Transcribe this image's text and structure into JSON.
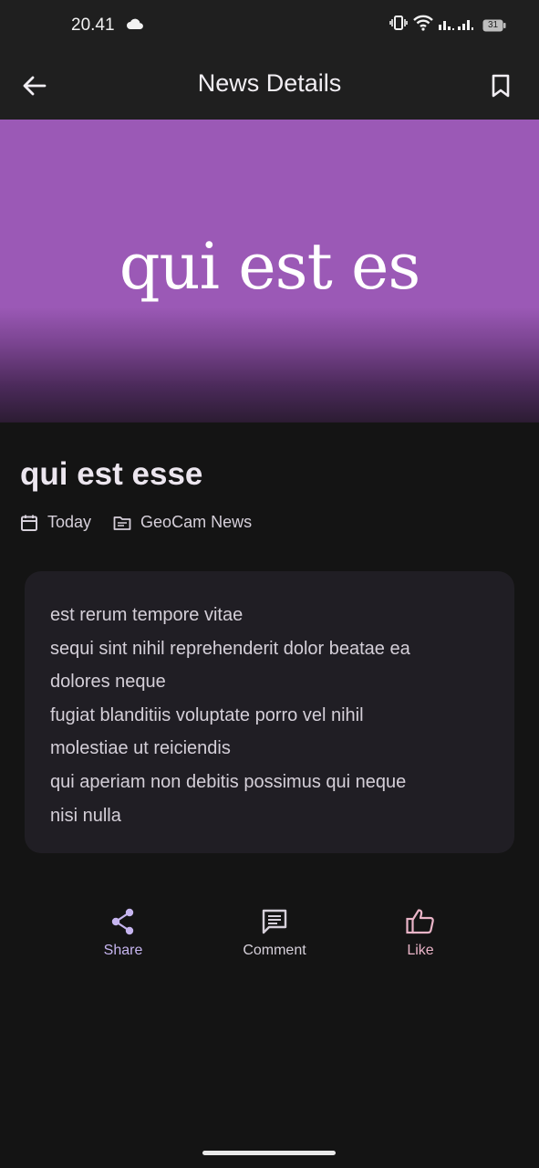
{
  "status_bar": {
    "time": "20.41",
    "battery_level": "31"
  },
  "app_bar": {
    "title": "News Details"
  },
  "hero": {
    "image_text": "qui est es",
    "color": "#9b59b6"
  },
  "article": {
    "title": "qui est esse",
    "date": "Today",
    "source": "GeoCam News",
    "body_lines": [
      "est rerum tempore vitae",
      "sequi sint nihil reprehenderit dolor beatae ea",
      "dolores neque",
      "fugiat blanditiis voluptate porro vel nihil",
      "molestiae ut reiciendis",
      "qui aperiam non debitis possimus qui neque",
      "nisi nulla"
    ]
  },
  "actions": {
    "share": "Share",
    "comment": "Comment",
    "like": "Like"
  },
  "colors": {
    "share": "#c6b5ef",
    "comment": "#d6d0da",
    "like": "#eab5c8"
  }
}
